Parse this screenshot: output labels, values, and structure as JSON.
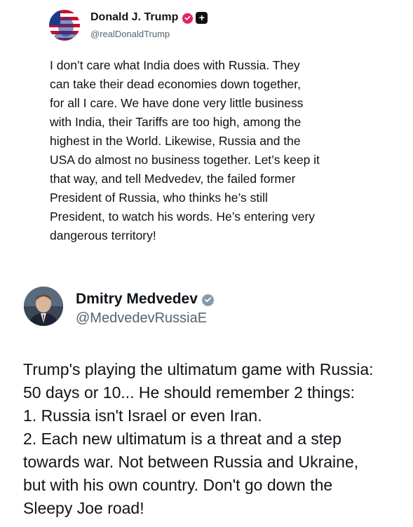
{
  "post1": {
    "author_name": "Donald J. Trump",
    "handle": "@realDonaldTrump",
    "avatar_icon": "flag-portrait-avatar",
    "verified_badge_icon": "verified-badge-icon",
    "plus_icon": "plus-square-icon",
    "plus_glyph": "+",
    "badge_color": "#e0245e",
    "body_lines": [
      "I don’t care what India does with Russia. They",
      "can take their dead economies down together,",
      "for all I care. We have done very little business",
      "with India, their Tariffs are too high, among the",
      "highest in the World. Likewise, Russia and the",
      "USA do almost no business together. Let’s keep it",
      "that way, and tell Medvedev, the failed former",
      "President of Russia, who thinks he’s still",
      "President, to watch his words. He’s entering very",
      "dangerous territory!"
    ]
  },
  "post2": {
    "author_name": "Dmitry Medvedev",
    "handle": "@MedvedevRussiaE",
    "avatar_icon": "portrait-avatar",
    "verified_badge_icon": "verified-badge-icon",
    "badge_color": "#829aab",
    "body_lines": [
      "Trump's playing the ultimatum game with Russia:",
      "50 days or 10... He should remember 2 things:",
      "1. Russia isn't Israel or even Iran.",
      "2. Each new ultimatum is a threat and a step",
      "towards war. Not between Russia and Ukraine,",
      "but with his own country. Don't go down the",
      "Sleepy Joe road!"
    ]
  }
}
